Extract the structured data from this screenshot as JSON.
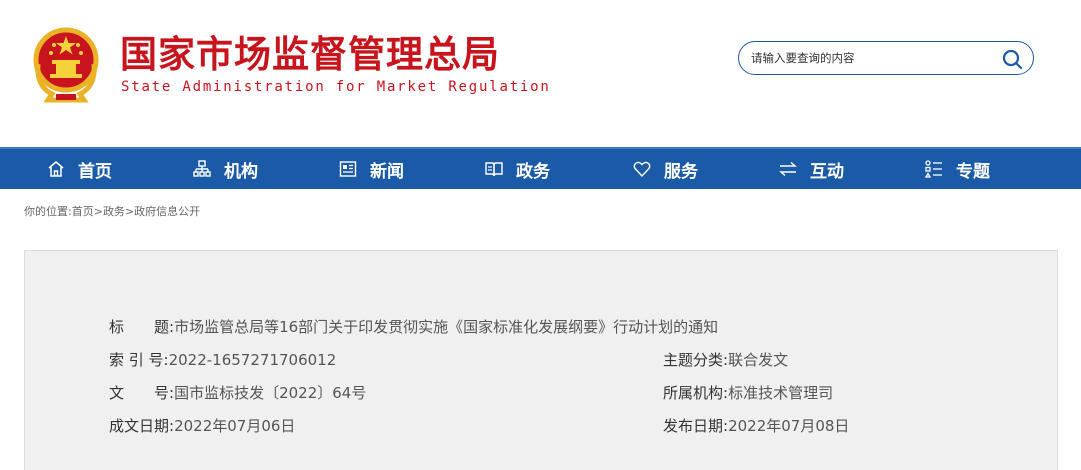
{
  "header": {
    "title": "国家市场监督管理总局",
    "subtitle": "State Administration for Market Regulation",
    "emblem_icon": "national-emblem-icon",
    "brand_color": "#c8151d"
  },
  "search": {
    "placeholder": "请输入要查询的内容",
    "icon": "search-icon"
  },
  "nav": {
    "background": "#1b5aa6",
    "items": [
      {
        "label": "首页",
        "icon": "home-icon"
      },
      {
        "label": "机构",
        "icon": "org-chart-icon"
      },
      {
        "label": "新闻",
        "icon": "newspaper-icon"
      },
      {
        "label": "政务",
        "icon": "book-icon"
      },
      {
        "label": "服务",
        "icon": "heart-icon"
      },
      {
        "label": "互动",
        "icon": "exchange-arrows-icon"
      },
      {
        "label": "专题",
        "icon": "topic-list-icon"
      }
    ]
  },
  "breadcrumb": {
    "prefix": "你的位置:",
    "items": [
      "首页",
      "政务",
      "政府信息公开"
    ],
    "separator": ">"
  },
  "info": {
    "title_label": "标　　题:",
    "title_value": "市场监管总局等16部门关于印发贯彻实施《国家标准化发展纲要》行动计划的通知",
    "index_label": "索 引 号:",
    "index_value": "2022-1657271706012",
    "category_label": "主题分类:",
    "category_value": "联合发文",
    "doc_label": "文　　号:",
    "doc_value": "国市监标技发〔2022〕64号",
    "org_label": "所属机构:",
    "org_value": "标准技术管理司",
    "written_label": "成文日期:",
    "written_value": "2022年07月06日",
    "publish_label": "发布日期:",
    "publish_value": "2022年07月08日"
  }
}
